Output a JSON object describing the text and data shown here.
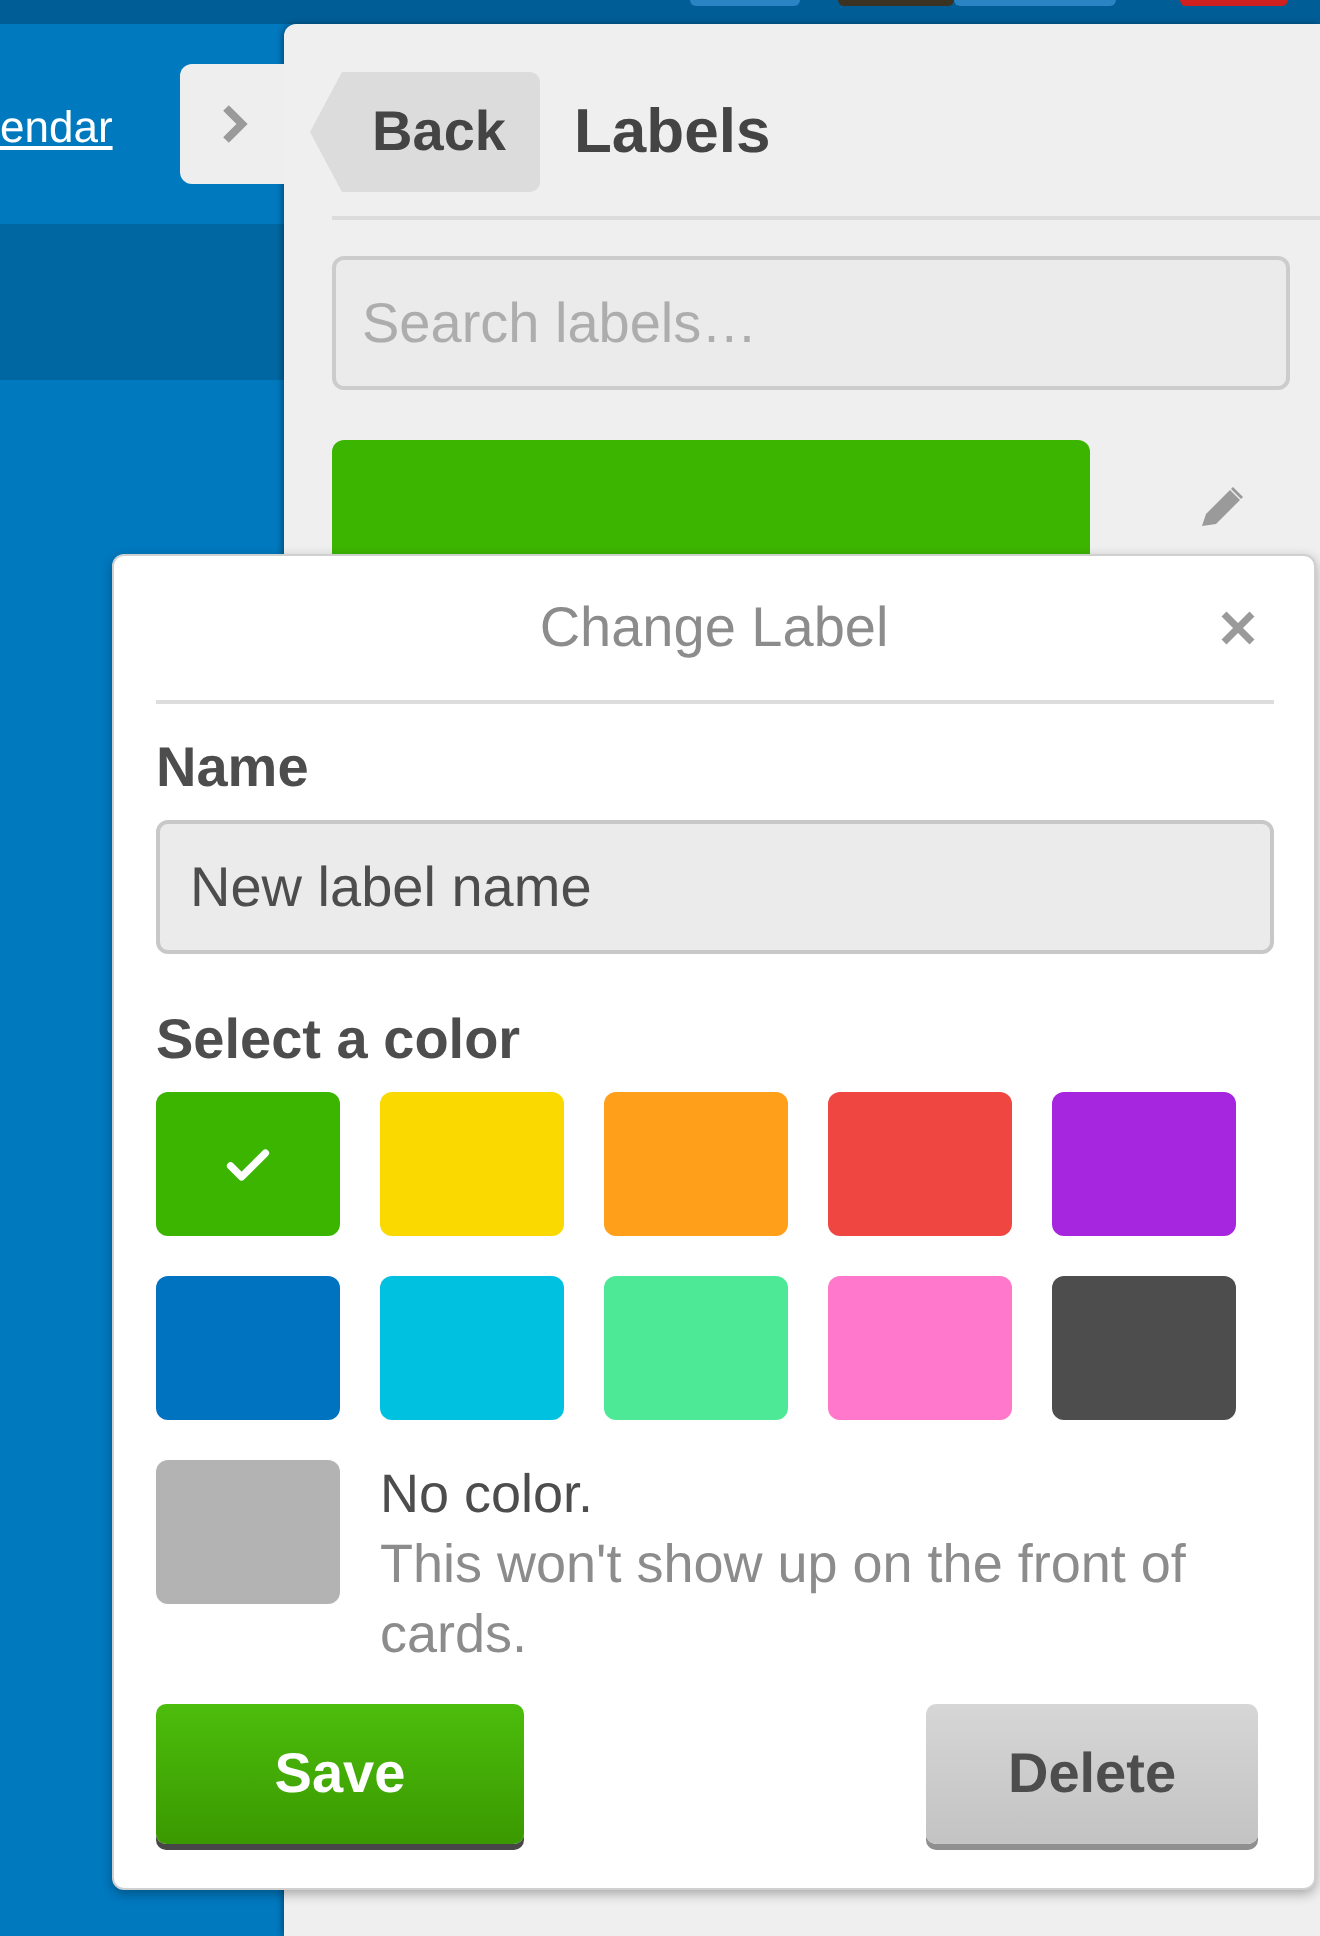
{
  "board": {
    "link": "endar"
  },
  "sidebar": {
    "back_button": "Back",
    "title": "Labels",
    "search": {
      "placeholder": "Search labels…"
    },
    "labels": [
      {
        "color": "#3cb500"
      }
    ]
  },
  "popup": {
    "title": "Change Label",
    "name_label": "Name",
    "name_field": {
      "value": "New label name"
    },
    "color_heading": "Select a color",
    "colors": [
      {
        "color": "#3cb500",
        "selected": true
      },
      {
        "color": "#fad900",
        "selected": false
      },
      {
        "color": "#ff9f1a",
        "selected": false
      },
      {
        "color": "#ef4641",
        "selected": false
      },
      {
        "color": "#a526de",
        "selected": false
      },
      {
        "color": "#0073c0",
        "selected": false
      },
      {
        "color": "#00c2e0",
        "selected": false
      },
      {
        "color": "#4de997",
        "selected": false
      },
      {
        "color": "#ff78cb",
        "selected": false
      },
      {
        "color": "#4d4d4d",
        "selected": false
      }
    ],
    "no_color": {
      "selected": false,
      "title": "No color.",
      "description": "This won't show up on the front of cards."
    },
    "buttons": [
      {
        "kind": "save",
        "label": "Save"
      },
      {
        "kind": "delete",
        "label": "Delete"
      }
    ]
  }
}
